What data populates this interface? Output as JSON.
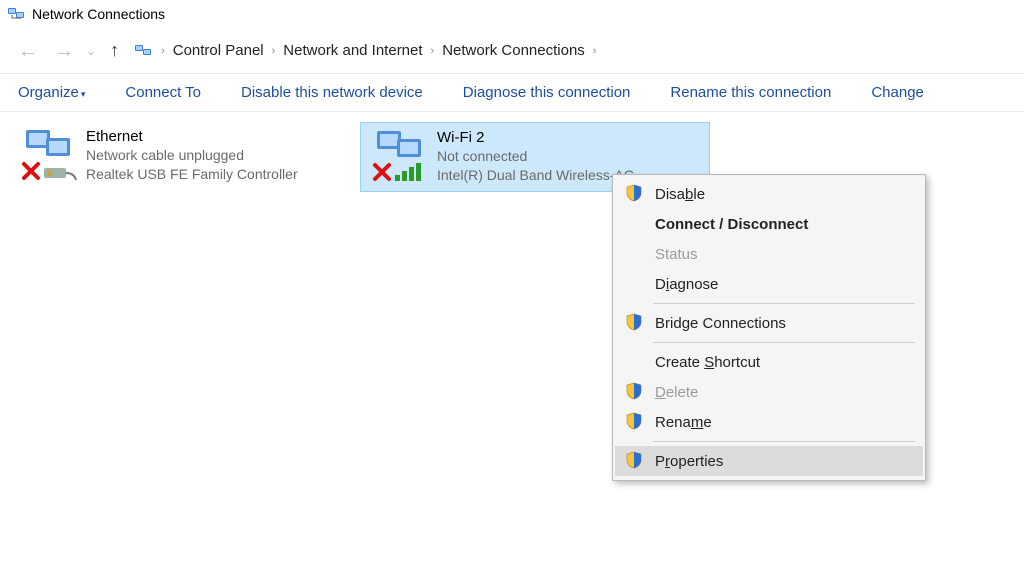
{
  "window": {
    "title": "Network Connections"
  },
  "breadcrumb": {
    "items": [
      "Control Panel",
      "Network and Internet",
      "Network Connections"
    ]
  },
  "toolbar": {
    "organize": "Organize",
    "connect": "Connect To",
    "disable": "Disable this network device",
    "diagnose": "Diagnose this connection",
    "rename": "Rename this connection",
    "change": "Change"
  },
  "adapters": [
    {
      "name": "Ethernet",
      "status": "Network cable unplugged",
      "device": "Realtek USB FE Family Controller",
      "selected": false,
      "overlay": "x-plug"
    },
    {
      "name": "Wi-Fi 2",
      "status": "Not connected",
      "device": "Intel(R) Dual Band Wireless-AC",
      "selected": true,
      "overlay": "x-bars"
    }
  ],
  "context_menu": {
    "disable": "Disable",
    "connect_disconnect": "Connect / Disconnect",
    "status": "Status",
    "diagnose": "Diagnose",
    "bridge": "Bridge Connections",
    "shortcut": "Create Shortcut",
    "delete": "Delete",
    "rename": "Rename",
    "properties": "Properties"
  }
}
